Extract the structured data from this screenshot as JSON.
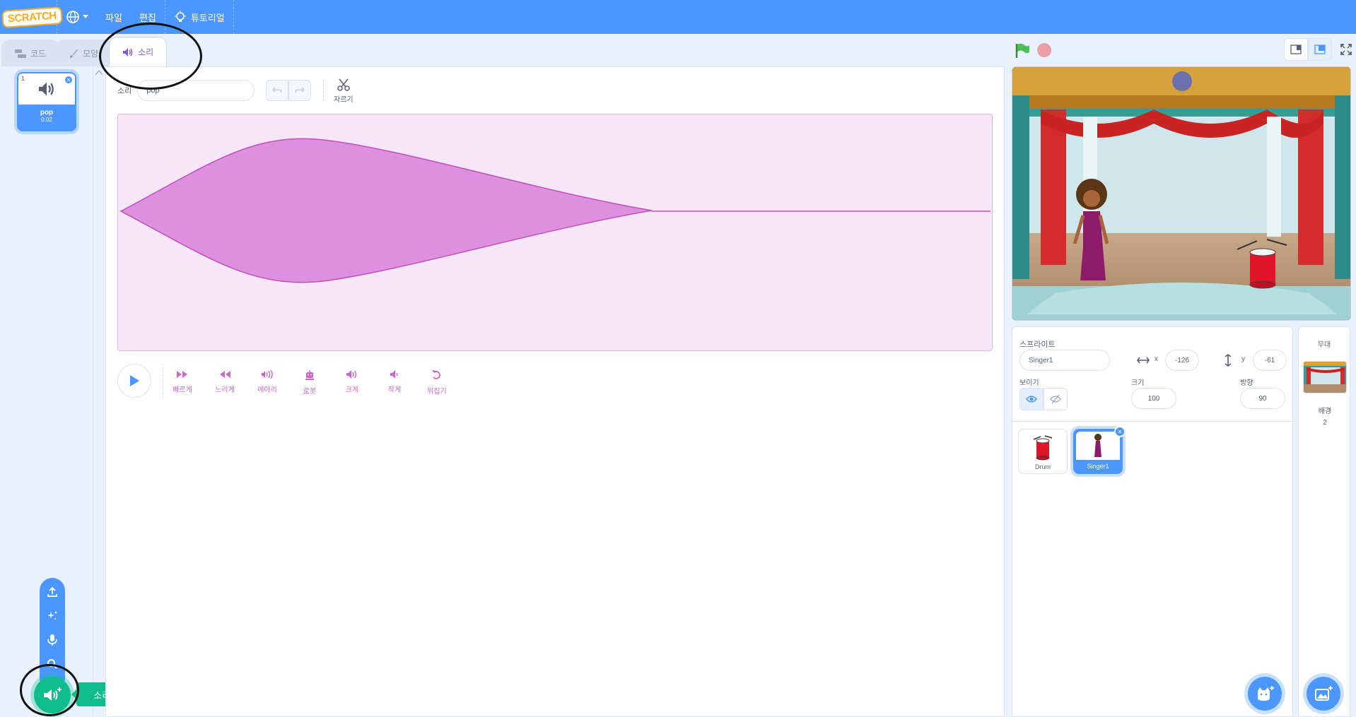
{
  "menubar": {
    "logo": "SCRATCH",
    "file": "파일",
    "edit": "편집",
    "tutorials": "튜토리얼"
  },
  "tabs": {
    "code": "코드",
    "costumes": "모양",
    "sounds": "소리"
  },
  "sound_list": {
    "items": [
      {
        "index": "1",
        "name": "pop",
        "duration": "0.02"
      }
    ]
  },
  "add_sound": {
    "tooltip": "소리 고르기"
  },
  "editor": {
    "sound_label": "소리",
    "sound_name": "pop",
    "trim_label": "자르기",
    "effects": [
      {
        "label": "빠르게",
        "icon": "faster-icon"
      },
      {
        "label": "느리게",
        "icon": "slower-icon"
      },
      {
        "label": "메아리",
        "icon": "echo-icon"
      },
      {
        "label": "로봇",
        "icon": "robot-icon"
      },
      {
        "label": "크게",
        "icon": "louder-icon"
      },
      {
        "label": "작게",
        "icon": "softer-icon"
      },
      {
        "label": "뒤집기",
        "icon": "reverse-icon"
      }
    ]
  },
  "sprite_info": {
    "sprite_label": "스프라이트",
    "sprite_name": "Singer1",
    "x_label": "x",
    "x_value": "-126",
    "y_label": "y",
    "y_value": "-61",
    "show_label": "보이기",
    "size_label": "크기",
    "size_value": "100",
    "direction_label": "방향",
    "direction_value": "90"
  },
  "sprites": [
    {
      "name": "Drum",
      "selected": false
    },
    {
      "name": "Singer1",
      "selected": true
    }
  ],
  "stage_col": {
    "header": "무대",
    "backdrop_label": "배경",
    "backdrop_count": "2"
  },
  "colors": {
    "menubar": "#4c97ff",
    "sound_accent": "#cf63cf",
    "add_sound": "#0fbd8c"
  }
}
